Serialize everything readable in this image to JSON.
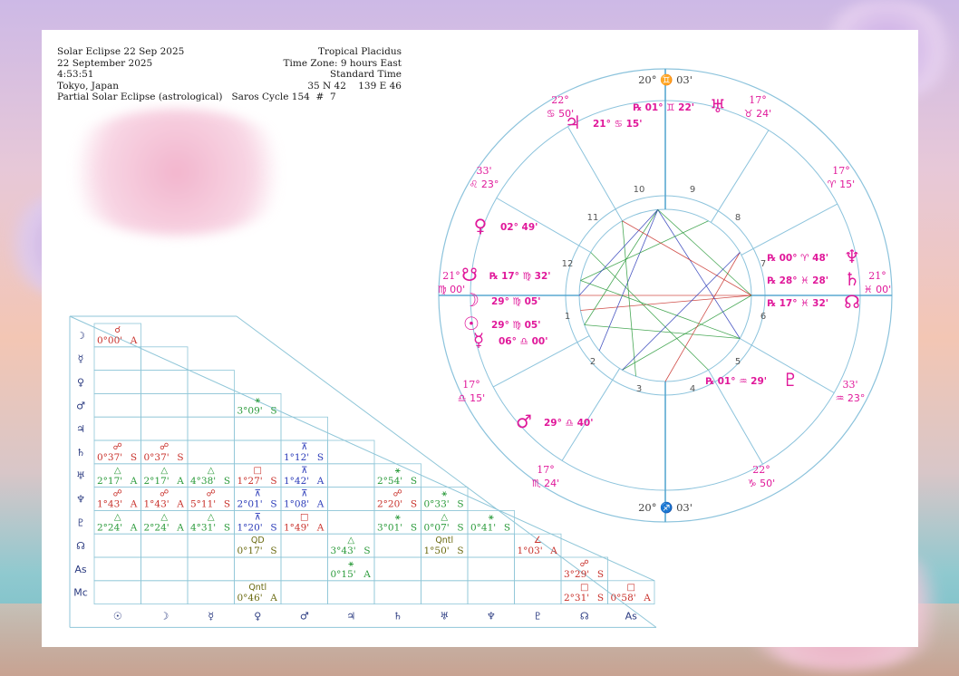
{
  "header": {
    "left": [
      "Solar Eclipse 22 Sep 2025",
      "22 September 2025",
      "4:53:51",
      "Tokyo, Japan"
    ],
    "bottom_line": "Partial Solar Eclipse (astrological)   Saros Cycle 154  #  7",
    "right": [
      "Tropical Placidus",
      "Time Zone: 9 hours East",
      "Standard Time",
      "35 N 42    139 E 46"
    ]
  },
  "colors": {
    "accent": "#e0189a",
    "line": "#8fc6d8",
    "red": "#c8302a",
    "green": "#2a9a3a",
    "blue": "#2a3ab8",
    "olive": "#6a6a10"
  },
  "planet_row_labels": [
    "☽",
    "☿",
    "♀",
    "♂",
    "♃",
    "♄",
    "♅",
    "♆",
    "♇",
    "☊",
    "As",
    "Mc"
  ],
  "planet_col_labels": [
    "☉",
    "☽",
    "☿",
    "♀",
    "♂",
    "♃",
    "♄",
    "♅",
    "♆",
    "♇",
    "☊",
    "As"
  ],
  "aspect_grid": [
    {
      "row": 0,
      "col": 0,
      "glyph": "☌",
      "text": "0°00'",
      "mode": "A",
      "color": "red"
    },
    {
      "row": 3,
      "col": 3,
      "glyph": "⚹",
      "text": "3°09'",
      "mode": "S",
      "color": "green"
    },
    {
      "row": 5,
      "col": 0,
      "glyph": "☍",
      "text": "0°37'",
      "mode": "S",
      "color": "red"
    },
    {
      "row": 5,
      "col": 1,
      "glyph": "☍",
      "text": "0°37'",
      "mode": "S",
      "color": "red"
    },
    {
      "row": 5,
      "col": 4,
      "glyph": "⊼",
      "text": "1°12'",
      "mode": "S",
      "color": "blue"
    },
    {
      "row": 6,
      "col": 0,
      "glyph": "△",
      "text": "2°17'",
      "mode": "A",
      "color": "green"
    },
    {
      "row": 6,
      "col": 1,
      "glyph": "△",
      "text": "2°17'",
      "mode": "A",
      "color": "green"
    },
    {
      "row": 6,
      "col": 2,
      "glyph": "△",
      "text": "4°38'",
      "mode": "S",
      "color": "green"
    },
    {
      "row": 6,
      "col": 3,
      "glyph": "□",
      "text": "1°27'",
      "mode": "S",
      "color": "red"
    },
    {
      "row": 6,
      "col": 4,
      "glyph": "⊼",
      "text": "1°42'",
      "mode": "A",
      "color": "blue"
    },
    {
      "row": 6,
      "col": 6,
      "glyph": "⚹",
      "text": "2°54'",
      "mode": "S",
      "color": "green"
    },
    {
      "row": 7,
      "col": 0,
      "glyph": "☍",
      "text": "1°43'",
      "mode": "A",
      "color": "red"
    },
    {
      "row": 7,
      "col": 1,
      "glyph": "☍",
      "text": "1°43'",
      "mode": "A",
      "color": "red"
    },
    {
      "row": 7,
      "col": 2,
      "glyph": "☍",
      "text": "5°11'",
      "mode": "S",
      "color": "red"
    },
    {
      "row": 7,
      "col": 3,
      "glyph": "⊼",
      "text": "2°01'",
      "mode": "S",
      "color": "blue"
    },
    {
      "row": 7,
      "col": 4,
      "glyph": "⊼",
      "text": "1°08'",
      "mode": "A",
      "color": "blue"
    },
    {
      "row": 7,
      "col": 6,
      "glyph": "☍",
      "text": "2°20'",
      "mode": "S",
      "color": "red"
    },
    {
      "row": 7,
      "col": 7,
      "glyph": "⚹",
      "text": "0°33'",
      "mode": "S",
      "color": "green"
    },
    {
      "row": 8,
      "col": 0,
      "glyph": "△",
      "text": "2°24'",
      "mode": "A",
      "color": "green"
    },
    {
      "row": 8,
      "col": 1,
      "glyph": "△",
      "text": "2°24'",
      "mode": "A",
      "color": "green"
    },
    {
      "row": 8,
      "col": 2,
      "glyph": "△",
      "text": "4°31'",
      "mode": "S",
      "color": "green"
    },
    {
      "row": 8,
      "col": 3,
      "glyph": "⊼",
      "text": "1°20'",
      "mode": "S",
      "color": "blue"
    },
    {
      "row": 8,
      "col": 4,
      "glyph": "□",
      "text": "1°49'",
      "mode": "A",
      "color": "red"
    },
    {
      "row": 8,
      "col": 6,
      "glyph": "⚹",
      "text": "3°01'",
      "mode": "S",
      "color": "green"
    },
    {
      "row": 8,
      "col": 7,
      "glyph": "△",
      "text": "0°07'",
      "mode": "S",
      "color": "green"
    },
    {
      "row": 8,
      "col": 8,
      "glyph": "⚹",
      "text": "0°41'",
      "mode": "S",
      "color": "green"
    },
    {
      "row": 9,
      "col": 3,
      "glyph": "QD",
      "text": "0°17'",
      "mode": "S",
      "color": "olive"
    },
    {
      "row": 9,
      "col": 5,
      "glyph": "△",
      "text": "3°43'",
      "mode": "S",
      "color": "green"
    },
    {
      "row": 9,
      "col": 7,
      "glyph": "Qntl",
      "text": "1°50'",
      "mode": "S",
      "color": "olive"
    },
    {
      "row": 9,
      "col": 9,
      "glyph": "∠",
      "text": "1°03'",
      "mode": "A",
      "color": "red"
    },
    {
      "row": 10,
      "col": 5,
      "glyph": "⚹",
      "text": "0°15'",
      "mode": "A",
      "color": "green"
    },
    {
      "row": 10,
      "col": 10,
      "glyph": "☍",
      "text": "3°29'",
      "mode": "S",
      "color": "red"
    },
    {
      "row": 11,
      "col": 3,
      "glyph": "Qntl",
      "text": "0°46'",
      "mode": "A",
      "color": "olive"
    },
    {
      "row": 11,
      "col": 10,
      "glyph": "□",
      "text": "2°31'",
      "mode": "S",
      "color": "red"
    },
    {
      "row": 11,
      "col": 11,
      "glyph": "□",
      "text": "0°58'",
      "mode": "A",
      "color": "red"
    }
  ],
  "wheel": {
    "mc_label": "20° ♊ 03'",
    "ic_label": "20° ♐ 03'",
    "cusp_labels": [
      {
        "text": "17°",
        "text2": "♉ 24'",
        "pos": "c11"
      },
      {
        "text": "17°",
        "text2": "♈ 15'",
        "pos": "c12"
      },
      {
        "text": "21°",
        "text2": "♓ 00'",
        "pos": "c1r"
      },
      {
        "text": "33'",
        "text2": "♒ 23°",
        "pos": "c2"
      },
      {
        "text": "22°",
        "text2": "♑ 50'",
        "pos": "c3"
      },
      {
        "text": "17°",
        "text2": "♏ 24'",
        "pos": "c5"
      },
      {
        "text": "17°",
        "text2": "♎ 15'",
        "pos": "c6"
      },
      {
        "text": "21°",
        "text2": "♍ 00'",
        "pos": "c7"
      },
      {
        "text": "33'",
        "text2": "♌ 23°",
        "pos": "c8"
      },
      {
        "text": "22°",
        "text2": "♋ 50'",
        "pos": "c9"
      }
    ],
    "house_numbers": [
      "1",
      "2",
      "3",
      "4",
      "5",
      "6",
      "7",
      "8",
      "9",
      "10",
      "11",
      "12"
    ],
    "planets": [
      {
        "glyph": "♅",
        "deg": "01°",
        "sign": "♊",
        "min": "22'",
        "retro": "℞"
      },
      {
        "glyph": "♃",
        "deg": "21°",
        "sign": "♋",
        "min": "15'",
        "retro": ""
      },
      {
        "glyph": "♀",
        "deg": "02°",
        "sign": "",
        "min": "49'",
        "retro": ""
      },
      {
        "glyph": "☋",
        "deg": "17°",
        "sign": "♍",
        "min": "32'",
        "retro": "℞"
      },
      {
        "glyph": "☽",
        "deg": "29°",
        "sign": "♍",
        "min": "05'",
        "retro": ""
      },
      {
        "glyph": "☉",
        "deg": "29°",
        "sign": "♍",
        "min": "05'",
        "retro": ""
      },
      {
        "glyph": "☿",
        "deg": "06°",
        "sign": "♎",
        "min": "00'",
        "retro": ""
      },
      {
        "glyph": "♂",
        "deg": "29°",
        "sign": "♎",
        "min": "40'",
        "retro": ""
      },
      {
        "glyph": "♇",
        "deg": "01°",
        "sign": "♒",
        "min": "29'",
        "retro": "℞"
      },
      {
        "glyph": "♆",
        "deg": "00°",
        "sign": "♈",
        "min": "48'",
        "retro": "℞"
      },
      {
        "glyph": "♄",
        "deg": "28°",
        "sign": "♓",
        "min": "28'",
        "retro": "℞"
      },
      {
        "glyph": "☊",
        "deg": "17°",
        "sign": "♓",
        "min": "32'",
        "retro": "℞"
      }
    ]
  }
}
